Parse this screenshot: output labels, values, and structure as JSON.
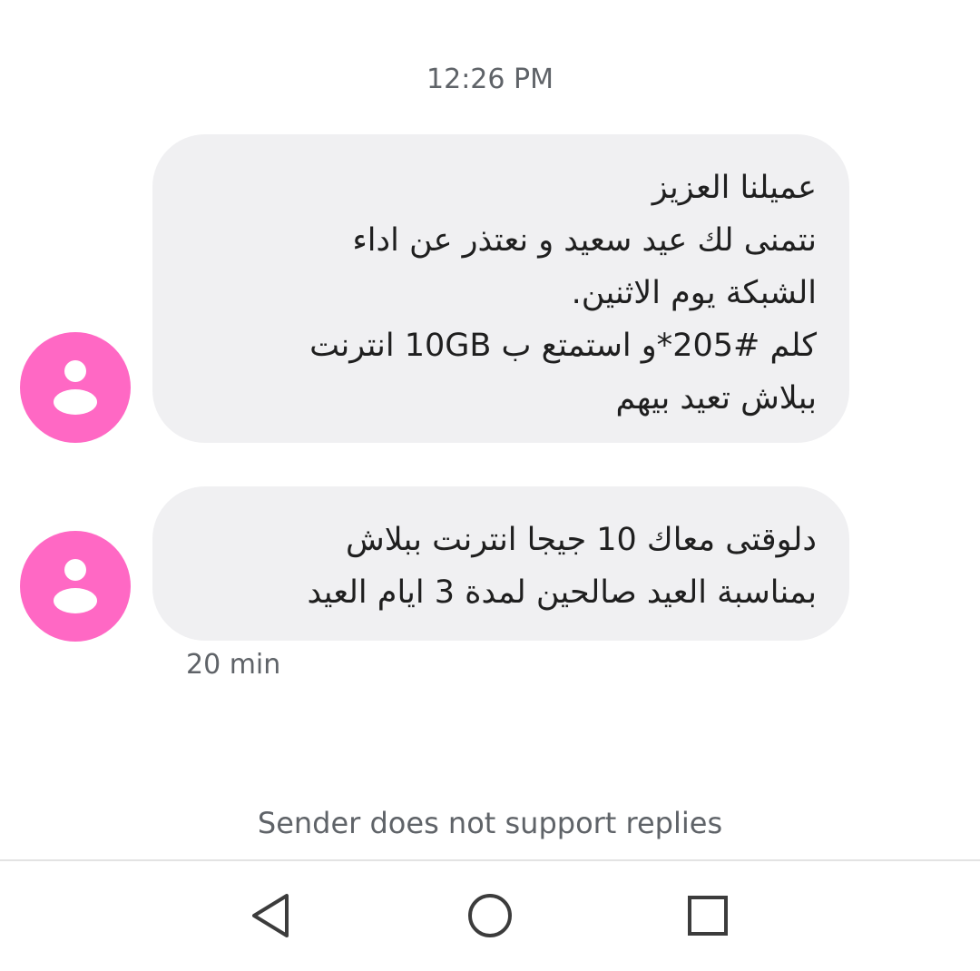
{
  "conversation": {
    "timestamp": "12:26 PM",
    "relative_time": "20 min",
    "reply_notice": "Sender does not support replies"
  },
  "messages": [
    {
      "avatar_icon": "person-icon",
      "avatar_color": "#ff68c4",
      "lines": [
        "عميلنا العزيز",
        "نتمنى لك عيد سعيد و نعتذر عن اداء",
        "الشبكة يوم الاثنين.",
        "كلم #205*و استمتع ب 10GB انترنت",
        "ببلاش تعيد بيهم"
      ]
    },
    {
      "avatar_icon": "person-icon",
      "avatar_color": "#ff68c4",
      "lines": [
        "دلوقتى معاك 10 جيجا انترنت  ببلاش",
        "بمناسبة العيد صالحين لمدة 3 ايام العيد"
      ]
    }
  ],
  "navbar": {
    "back_icon": "back-triangle-icon",
    "home_icon": "home-circle-icon",
    "recents_icon": "recents-square-icon"
  },
  "colors": {
    "bubble_bg": "#f0f0f2",
    "avatar": "#ff68c4",
    "secondary_text": "#5f6368"
  }
}
